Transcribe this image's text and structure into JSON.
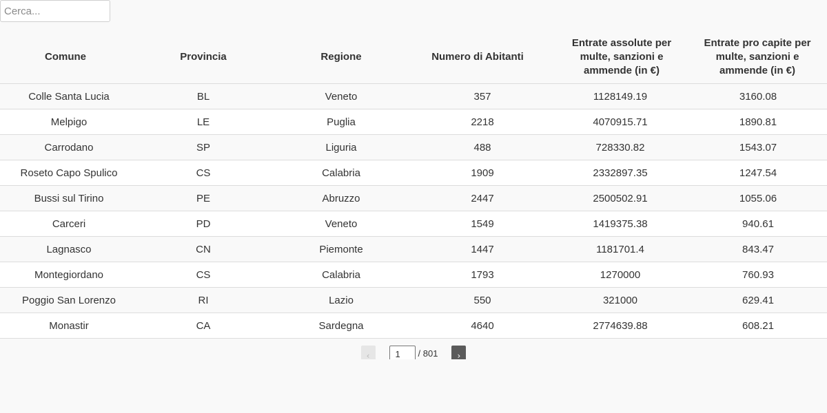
{
  "search": {
    "placeholder": "Cerca...",
    "value": ""
  },
  "table": {
    "headers": [
      "Comune",
      "Provincia",
      "Regione",
      "Numero di Abitanti",
      "Entrate assolute per multe, sanzioni e ammende (in €)",
      "Entrate pro capite per multe, sanzioni e ammende (in €)"
    ],
    "rows": [
      [
        "Colle Santa Lucia",
        "BL",
        "Veneto",
        "357",
        "1128149.19",
        "3160.08"
      ],
      [
        "Melpigo",
        "LE",
        "Puglia",
        "2218",
        "4070915.71",
        "1890.81"
      ],
      [
        "Carrodano",
        "SP",
        "Liguria",
        "488",
        "728330.82",
        "1543.07"
      ],
      [
        "Roseto Capo Spulico",
        "CS",
        "Calabria",
        "1909",
        "2332897.35",
        "1247.54"
      ],
      [
        "Bussi sul Tirino",
        "PE",
        "Abruzzo",
        "2447",
        "2500502.91",
        "1055.06"
      ],
      [
        "Carceri",
        "PD",
        "Veneto",
        "1549",
        "1419375.38",
        "940.61"
      ],
      [
        "Lagnasco",
        "CN",
        "Piemonte",
        "1447",
        "1181701.4",
        "843.47"
      ],
      [
        "Montegiordano",
        "CS",
        "Calabria",
        "1793",
        "1270000",
        "760.93"
      ],
      [
        "Poggio San Lorenzo",
        "RI",
        "Lazio",
        "550",
        "321000",
        "629.41"
      ],
      [
        "Monastir",
        "CA",
        "Sardegna",
        "4640",
        "2774639.88",
        "608.21"
      ]
    ]
  },
  "pagination": {
    "prev_label": "‹",
    "next_label": "›",
    "current_page": "1",
    "total_label": "/ 801"
  }
}
